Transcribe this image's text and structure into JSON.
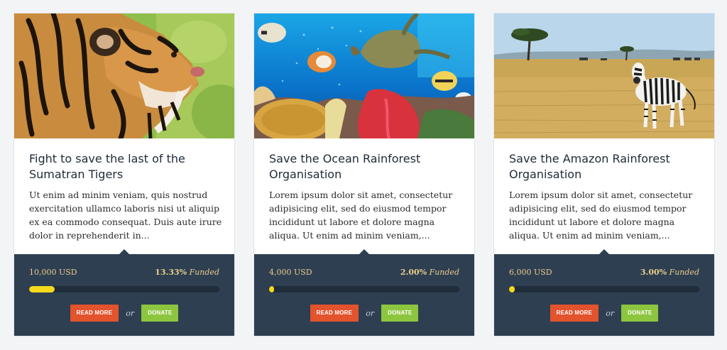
{
  "colors": {
    "footer_bg": "#2e3f51",
    "progress_fill": "#f4d91c",
    "progress_track": "#1f2c3a",
    "read_more_button": "#e3532d",
    "donate_button": "#8cc63f",
    "amount_text": "#e9cc8a"
  },
  "cards": [
    {
      "image_name": "tiger-image",
      "title": "Fight to save the last of the Sumatran Tigers",
      "excerpt": "Ut enim ad minim veniam, quis nostrud exercitation ullamco laboris nisi ut aliquip ex ea commodo consequat. Duis aute irure dolor in reprehenderit in...",
      "goal": "10,000 USD",
      "funded_percent": "13.33%",
      "funded_label": "Funded",
      "progress": 0.1333,
      "read_more_label": "Read More",
      "or_label": "or",
      "donate_label": "Donate"
    },
    {
      "image_name": "ocean-reef-image",
      "title": "Save the Ocean Rainforest Organisation",
      "excerpt": "Lorem ipsum dolor sit amet, consectetur adipisicing elit, sed do eiusmod tempor incididunt ut labore et dolore magna aliqua. Ut enim ad minim veniam,...",
      "goal": "4,000 USD",
      "funded_percent": "2.00%",
      "funded_label": "Funded",
      "progress": 0.02,
      "read_more_label": "Read More",
      "or_label": "or",
      "donate_label": "Donate"
    },
    {
      "image_name": "savanna-zebra-image",
      "title": "Save the Amazon Rainforest Organisation",
      "excerpt": "Lorem ipsum dolor sit amet, consectetur adipisicing elit, sed do eiusmod tempor incididunt ut labore et dolore magna aliqua. Ut enim ad minim veniam,...",
      "goal": "6,000 USD",
      "funded_percent": "3.00%",
      "funded_label": "Funded",
      "progress": 0.03,
      "read_more_label": "Read More",
      "or_label": "or",
      "donate_label": "Donate"
    }
  ]
}
